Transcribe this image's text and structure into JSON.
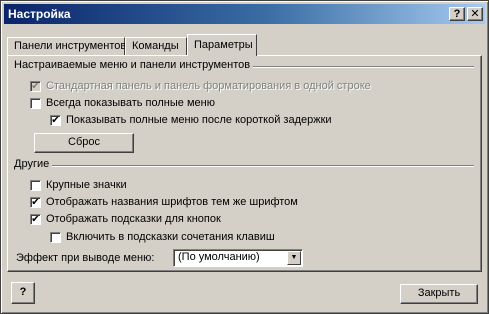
{
  "window": {
    "title": "Настройка",
    "help_glyph": "?",
    "close_glyph": "✕"
  },
  "tabs": [
    {
      "label": "Панели инструментов"
    },
    {
      "label": "Команды"
    },
    {
      "label": "Параметры"
    }
  ],
  "menus_group": {
    "title": "Настраиваемые меню и панели инструментов",
    "standard_formatting_same_row": {
      "label": "Стандартная панель и панель форматирования в одной строке",
      "checked": true,
      "enabled": false
    },
    "always_full_menus": {
      "label": "Всегда показывать полные меню",
      "checked": false
    },
    "full_menus_after_delay": {
      "label": "Показывать полные меню после короткой задержки",
      "checked": true
    },
    "reset_button": "Сброс"
  },
  "other_group": {
    "title": "Другие",
    "large_icons": {
      "label": "Крупные значки",
      "checked": false
    },
    "font_names_in_font": {
      "label": "Отображать названия шрифтов тем же шрифтом",
      "checked": true
    },
    "show_tooltips": {
      "label": "Отображать подсказки для кнопок",
      "checked": true
    },
    "shortcut_keys_in_tooltips": {
      "label": "Включить в подсказки сочетания клавиш",
      "checked": false
    },
    "menu_animation_label": "Эффект при выводе меню:",
    "menu_animation_value": "(По умолчанию)"
  },
  "footer": {
    "help_icon_glyph": "?",
    "close_button": "Закрыть"
  },
  "check_glyph": "✔"
}
